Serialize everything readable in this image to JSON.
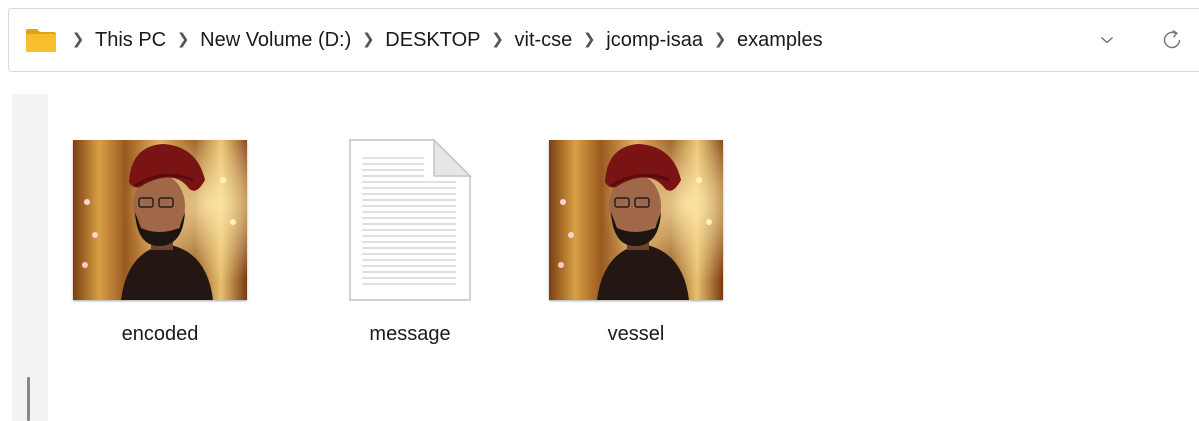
{
  "address_bar": {
    "folder_icon": "folder-icon",
    "separator_icon": "chevron-right-icon",
    "crumbs": [
      "This PC",
      "New Volume (D:)",
      "DESKTOP",
      "vit-cse",
      "jcomp-isaa",
      "examples"
    ],
    "dropdown_icon": "chevron-down-icon",
    "refresh_icon": "refresh-icon"
  },
  "files": [
    {
      "name": "encoded",
      "type": "image",
      "icon": "photo-thumbnail"
    },
    {
      "name": "message",
      "type": "text",
      "icon": "text-file-icon"
    },
    {
      "name": "vessel",
      "type": "image",
      "icon": "photo-thumbnail"
    }
  ],
  "colors": {
    "folder_yellow": "#f5c02b",
    "address_border": "#dadada",
    "nav_pane": "#f3f3f3"
  }
}
